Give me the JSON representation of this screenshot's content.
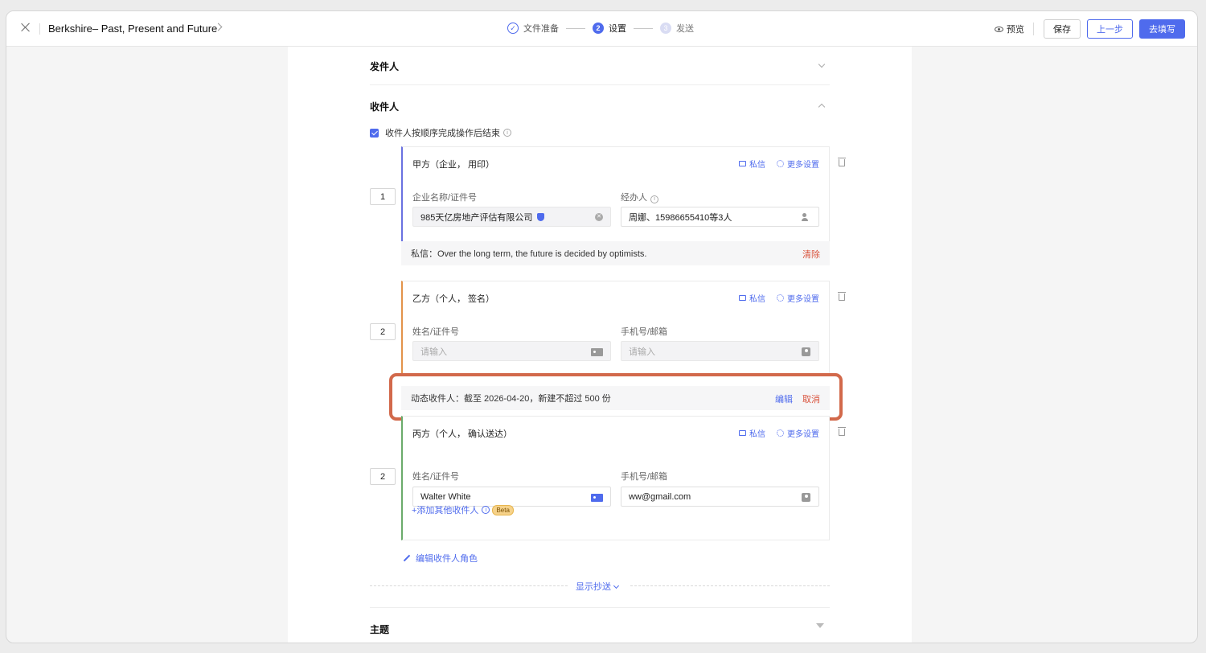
{
  "header": {
    "doc_title": "Berkshire– Past, Present and Future",
    "steps": [
      {
        "num": "✓",
        "label": "文件准备",
        "state": "done"
      },
      {
        "num": "2",
        "label": "设置",
        "state": "active"
      },
      {
        "num": "3",
        "label": "发送",
        "state": "todo"
      }
    ],
    "preview_label": "预览",
    "save_label": "保存",
    "prev_label": "上一步",
    "fill_label": "去填写"
  },
  "sections": {
    "sender_title": "发件人",
    "recipients_title": "收件人",
    "sequential_label": "收件人按顺序完成操作后结束",
    "subject_title": "主题"
  },
  "recipients": [
    {
      "order": "1",
      "title": "甲方（企业， 用印）",
      "private_msg_link": "私信",
      "more_settings_link": "更多设置",
      "left_label": "企业名称/证件号",
      "left_value": "985天亿房地产评估有限公司",
      "right_label": "经办人",
      "right_value": "周娜、15986655410等3人",
      "message": "私信：Over the long term, the future is decided by optimists.",
      "clear_label": "清除"
    },
    {
      "order": "2",
      "title": "乙方（个人， 签名）",
      "private_msg_link": "私信",
      "more_settings_link": "更多设置",
      "left_label": "姓名/证件号",
      "left_placeholder": "请输入",
      "right_label": "手机号/邮箱",
      "right_placeholder": "请输入",
      "dynamic_text": "动态收件人：截至 2026-04-20，新建不超过 500 份",
      "edit_label": "编辑",
      "cancel_label": "取消"
    },
    {
      "order": "2",
      "title": "丙方（个人， 确认送达）",
      "private_msg_link": "私信",
      "more_settings_link": "更多设置",
      "left_label": "姓名/证件号",
      "left_value": "Walter White",
      "right_label": "手机号/邮箱",
      "right_value": "ww@gmail.com",
      "add_other_label": "+添加其他收件人",
      "beta_label": "Beta"
    }
  ],
  "edit_roles_label": "编辑收件人角色",
  "show_cc_label": "显示抄送",
  "colors": {
    "accent": "#4f6bed",
    "party_a": "#6a72e0",
    "party_b": "#e3934a",
    "party_c": "#6bab6b",
    "danger": "#d9523b",
    "highlight": "#d2694b"
  }
}
